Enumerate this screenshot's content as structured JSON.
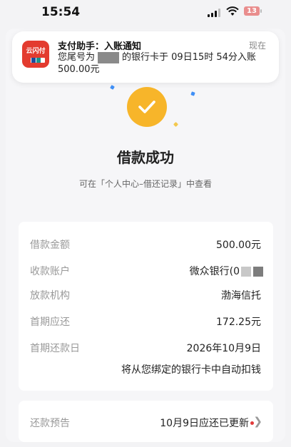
{
  "status_bar": {
    "time": "15:54",
    "battery": "13"
  },
  "notification": {
    "title": "支付助手：入账通知",
    "time": "现在",
    "body_prefix": "您尾号为",
    "body_middle": "的银行卡于 09日15时 54分入账",
    "body_amount": "500.00元",
    "app_logo": "云闪付"
  },
  "result": {
    "title": "借款成功",
    "subtitle": "可在「个人中心–借还记录」中查看"
  },
  "details": {
    "rows": [
      {
        "label": "借款金额",
        "value": "500.00元"
      },
      {
        "label": "收款账户",
        "value": "微众银行(0"
      },
      {
        "label": "放款机构",
        "value": "渤海信托"
      },
      {
        "label": "首期应还",
        "value": "172.25元"
      },
      {
        "label": "首期还款日",
        "value": "2026年10月9日"
      }
    ],
    "auto_debit_note": "将从您绑定的银行卡中自动扣钱"
  },
  "repayment_preview": {
    "label": "还款预告",
    "value": "10月9日应还已更新"
  },
  "colors": {
    "accent": "#f7b52a",
    "brand_red": "#e33b2f",
    "unread_dot": "#e23b3b"
  }
}
